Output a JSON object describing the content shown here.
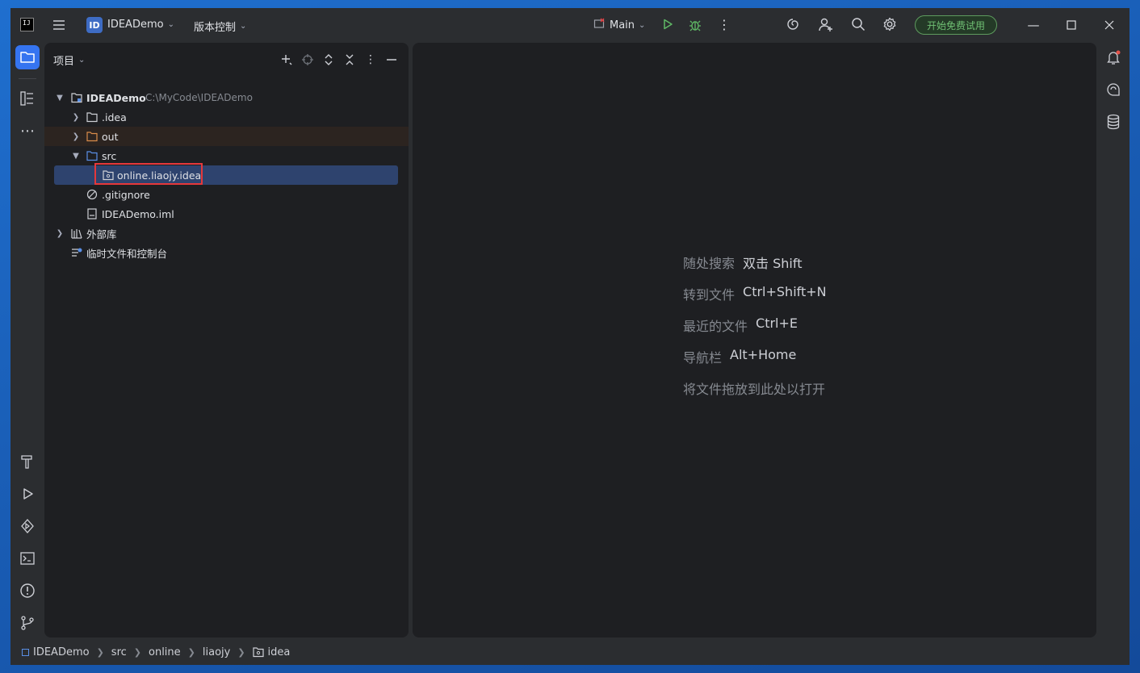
{
  "titlebar": {
    "logo_text": "IJ",
    "project_badge": "ID",
    "project_name": "IDEADemo",
    "vcs_label": "版本控制",
    "run_config": "Main",
    "trial_label": "开始免费试用",
    "icons": [
      "hamburger-menu-icon",
      "run-icon",
      "debug-icon",
      "more-vert-icon",
      "ai-spiral-icon",
      "add-user-icon",
      "search-icon",
      "settings-gear-icon",
      "minimize-icon",
      "maximize-icon",
      "close-icon"
    ]
  },
  "left_stripe": {
    "icons": [
      "project-folder-icon",
      "structure-icon",
      "more-horizontal-icon",
      "build-hammer-icon",
      "run-icon",
      "services-icon",
      "terminal-icon",
      "problems-icon",
      "git-icon"
    ]
  },
  "right_stripe": {
    "icons": [
      "notifications-bell-icon",
      "ai-chat-icon",
      "database-icon"
    ]
  },
  "project_panel": {
    "title": "项目",
    "tree": [
      {
        "label": "IDEADemo",
        "path": "C:\\MyCode\\IDEADemo",
        "level": 0,
        "expanded": true,
        "icon": "module-folder-icon"
      },
      {
        "label": ".idea",
        "level": 1,
        "expanded": false,
        "icon": "folder-icon"
      },
      {
        "label": "out",
        "level": 1,
        "expanded": false,
        "icon": "excluded-folder-icon"
      },
      {
        "label": "src",
        "level": 1,
        "expanded": true,
        "icon": "source-folder-icon"
      },
      {
        "label": "online.liaojy.idea",
        "level": 2,
        "selected": true,
        "icon": "package-icon"
      },
      {
        "label": ".gitignore",
        "level": 1,
        "icon": "ignore-file-icon"
      },
      {
        "label": "IDEADemo.iml",
        "level": 1,
        "icon": "iml-file-icon"
      },
      {
        "label": "外部库",
        "level": 0,
        "expanded": false,
        "icon": "library-icon"
      },
      {
        "label": "临时文件和控制台",
        "level": 0,
        "icon": "scratches-icon"
      }
    ]
  },
  "editor": {
    "hints": [
      {
        "action": "随处搜索",
        "shortcut": "双击 Shift"
      },
      {
        "action": "转到文件",
        "shortcut": "Ctrl+Shift+N"
      },
      {
        "action": "最近的文件",
        "shortcut": "Ctrl+E"
      },
      {
        "action": "导航栏",
        "shortcut": "Alt+Home"
      },
      {
        "action": "将文件拖放到此处以打开",
        "shortcut": ""
      }
    ]
  },
  "statusbar": {
    "breadcrumbs": [
      "IDEADemo",
      "src",
      "online",
      "liaojy",
      "idea"
    ]
  },
  "colors": {
    "accent": "#3574f0",
    "selection": "#2e436e",
    "highlight_box": "#e5383b",
    "trial_green": "#6fbf73"
  }
}
